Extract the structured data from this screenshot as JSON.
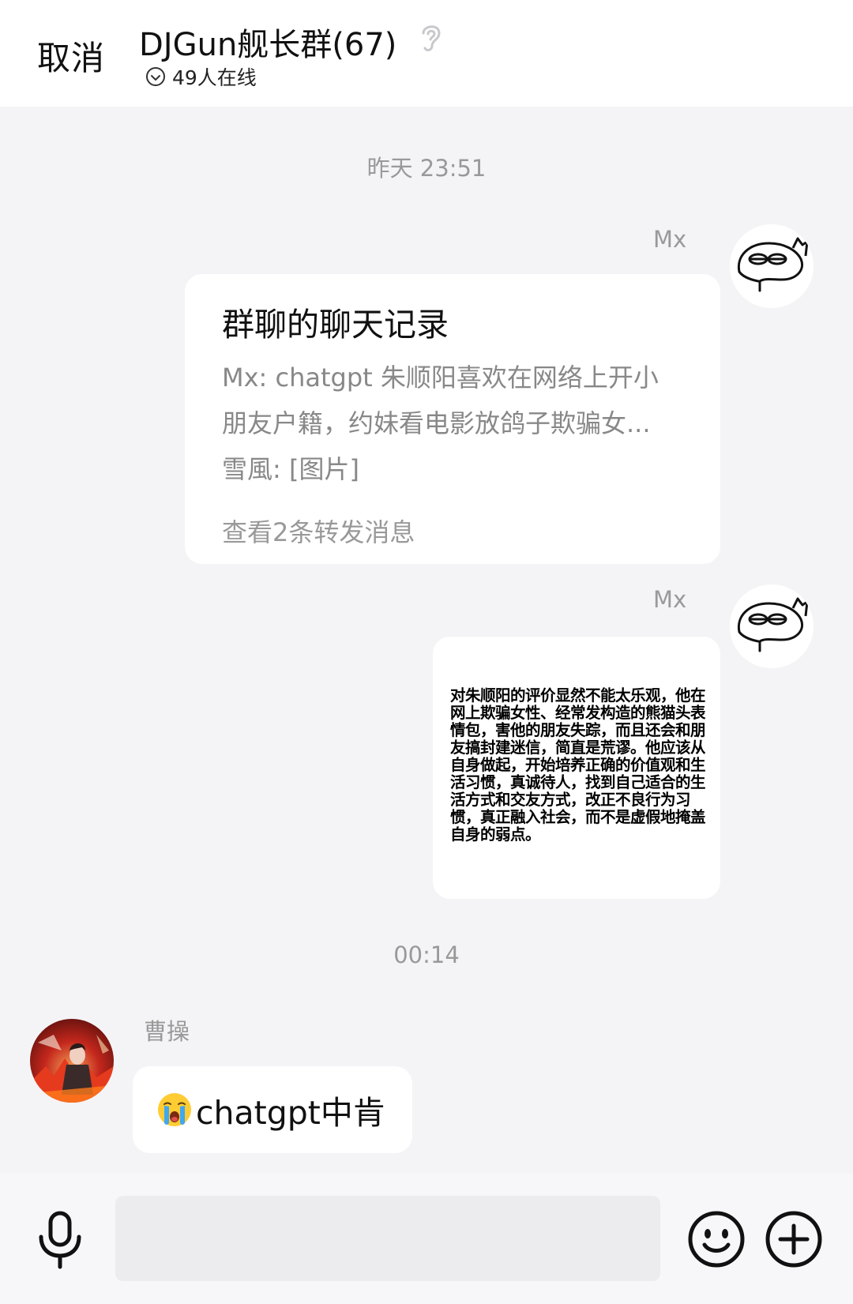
{
  "header": {
    "cancel_label": "取消",
    "title": "DJGun舰长群(67)",
    "online_status": "49人在线"
  },
  "messages": {
    "timestamp_1": "昨天 23:51",
    "msg1": {
      "sender": "Mx",
      "card_title": "群聊的聊天记录",
      "line_1": "Mx:  chatgpt 朱顺阳喜欢在网络上开小",
      "line_2": "朋友户籍，约妹看电影放鸽子欺骗女...",
      "line_3": "雪風:  [图片]",
      "view_link": "查看2条转发消息"
    },
    "msg2": {
      "sender": "Mx",
      "image_text": "对朱顺阳的评价显然不能太乐观，他在网上欺骗女性、经常发构造的熊猫头表情包，害他的朋友失踪，而且还会和朋友搞封建迷信，简直是荒谬。他应该从自身做起，开始培养正确的价值观和生活习惯，真诚待人，找到自己适合的生活方式和交友方式，改正不良行为习惯，真正融入社会，而不是虚假地掩盖自身的弱点。"
    },
    "timestamp_2": "00:14",
    "msg3": {
      "sender": "曹操",
      "text": "chatgpt中肯"
    }
  },
  "input": {
    "placeholder": ""
  },
  "icons": {
    "mic": "microphone-icon",
    "emoji": "smiley-icon",
    "plus": "plus-circle-icon",
    "ear": "ear-icon",
    "online": "check-circle-icon"
  }
}
